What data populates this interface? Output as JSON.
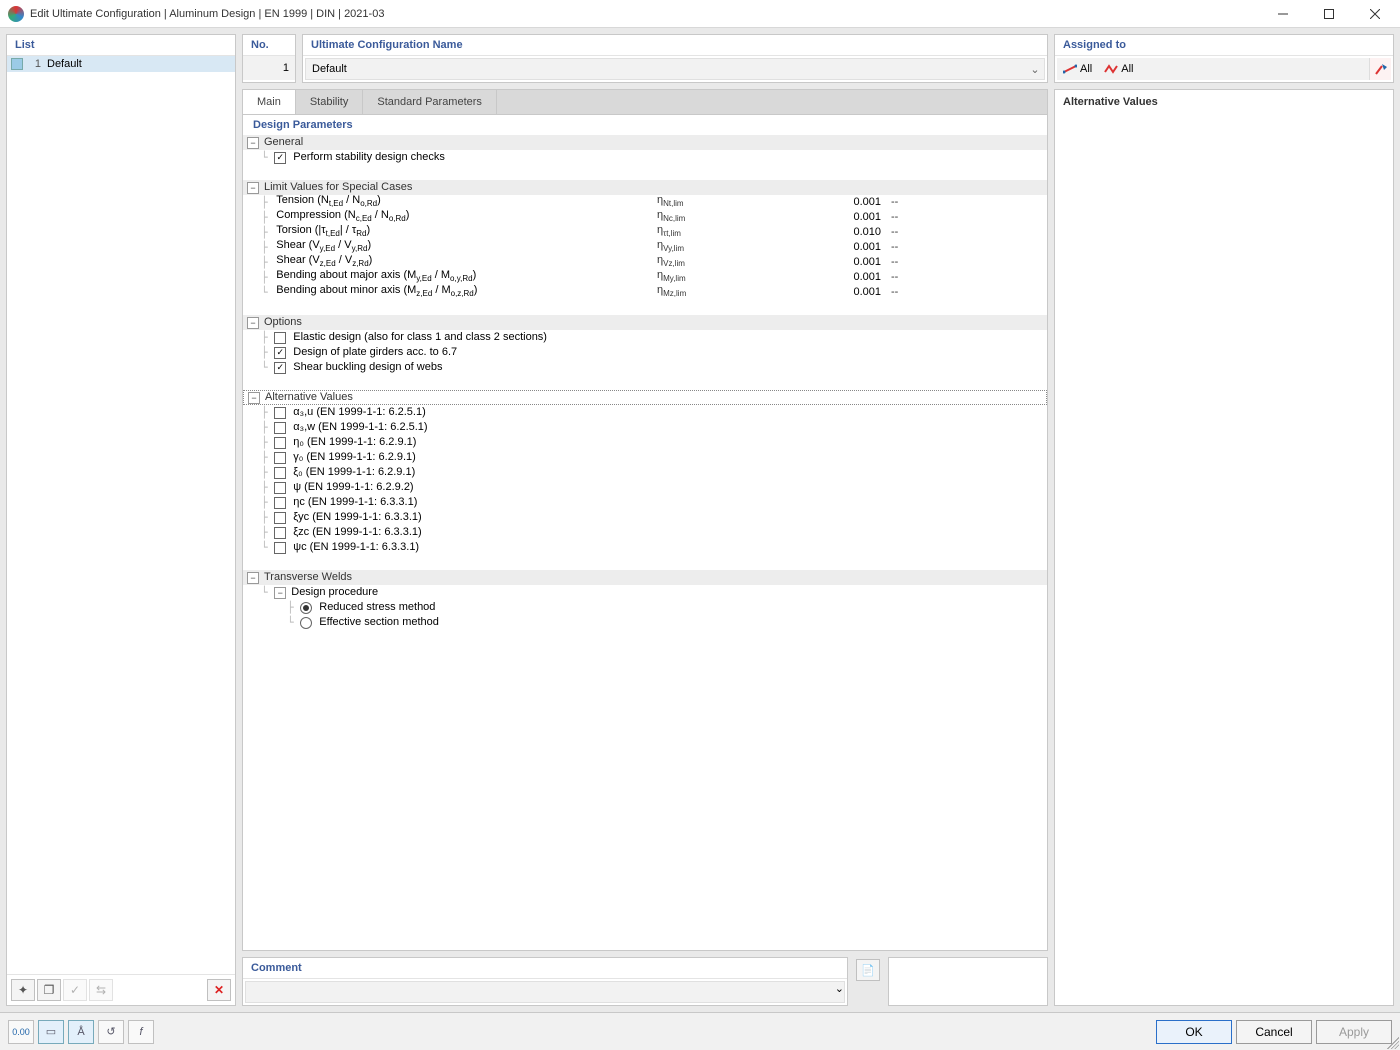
{
  "window": {
    "title": "Edit Ultimate Configuration | Aluminum Design | EN 1999 | DIN | 2021-03"
  },
  "list": {
    "header": "List",
    "items": [
      {
        "index": "1",
        "name": "Default"
      }
    ]
  },
  "no": {
    "header": "No.",
    "value": "1"
  },
  "name": {
    "header": "Ultimate Configuration Name",
    "value": "Default"
  },
  "assigned": {
    "header": "Assigned to",
    "tags": [
      "All",
      "All"
    ]
  },
  "tabs": [
    "Main",
    "Stability",
    "Standard Parameters"
  ],
  "params_header": "Design Parameters",
  "general": {
    "title": "General",
    "stability": "Perform stability design checks"
  },
  "limits": {
    "title": "Limit Values for Special Cases",
    "rows": [
      {
        "label": "Tension (N",
        "sub": "t,Ed",
        "label2": " / N",
        "sub2": "o,Rd",
        "label3": ")",
        "sym": "η",
        "ssub": "Nt,lim",
        "val": "0.001",
        "unit": "--"
      },
      {
        "label": "Compression (N",
        "sub": "c,Ed",
        "label2": " / N",
        "sub2": "o,Rd",
        "label3": ")",
        "sym": "η",
        "ssub": "Nc,lim",
        "val": "0.001",
        "unit": "--"
      },
      {
        "label": "Torsion (|τ",
        "sub": "t,Ed",
        "label2": "| / τ",
        "sub2": "Rd",
        "label3": ")",
        "sym": "η",
        "ssub": "τt,lim",
        "val": "0.010",
        "unit": "--"
      },
      {
        "label": "Shear (V",
        "sub": "y,Ed",
        "label2": " / V",
        "sub2": "y,Rd",
        "label3": ")",
        "sym": "η",
        "ssub": "Vy,lim",
        "val": "0.001",
        "unit": "--"
      },
      {
        "label": "Shear (V",
        "sub": "z,Ed",
        "label2": " / V",
        "sub2": "z,Rd",
        "label3": ")",
        "sym": "η",
        "ssub": "Vz,lim",
        "val": "0.001",
        "unit": "--"
      },
      {
        "label": "Bending about major axis (M",
        "sub": "y,Ed",
        "label2": " / M",
        "sub2": "o,y,Rd",
        "label3": ")",
        "sym": "η",
        "ssub": "My,lim",
        "val": "0.001",
        "unit": "--"
      },
      {
        "label": "Bending about minor axis (M",
        "sub": "z,Ed",
        "label2": " / M",
        "sub2": "o,z,Rd",
        "label3": ")",
        "sym": "η",
        "ssub": "Mz,lim",
        "val": "0.001",
        "unit": "--"
      }
    ]
  },
  "options": {
    "title": "Options",
    "items": [
      {
        "checked": false,
        "label": "Elastic design (also for class 1 and class 2 sections)"
      },
      {
        "checked": true,
        "label": "Design of plate girders acc. to 6.7"
      },
      {
        "checked": true,
        "label": "Shear buckling design of webs"
      }
    ]
  },
  "alt": {
    "title": "Alternative Values",
    "items": [
      "α₃,u (EN 1999-1-1: 6.2.5.1)",
      "α₃,w (EN 1999-1-1: 6.2.5.1)",
      "η₀ (EN 1999-1-1: 6.2.9.1)",
      "γ₀ (EN 1999-1-1: 6.2.9.1)",
      "ξ₀ (EN 1999-1-1: 6.2.9.1)",
      "ψ (EN 1999-1-1: 6.2.9.2)",
      "ηc (EN 1999-1-1: 6.3.3.1)",
      "ξyc (EN 1999-1-1: 6.3.3.1)",
      "ξzc (EN 1999-1-1: 6.3.3.1)",
      "ψc (EN 1999-1-1: 6.3.3.1)"
    ]
  },
  "welds": {
    "title": "Transverse Welds",
    "sub": "Design procedure",
    "r1": "Reduced stress method",
    "r2": "Effective section method"
  },
  "comment": {
    "header": "Comment"
  },
  "right_alt": {
    "header": "Alternative Values"
  },
  "buttons": {
    "ok": "OK",
    "cancel": "Cancel",
    "apply": "Apply"
  }
}
